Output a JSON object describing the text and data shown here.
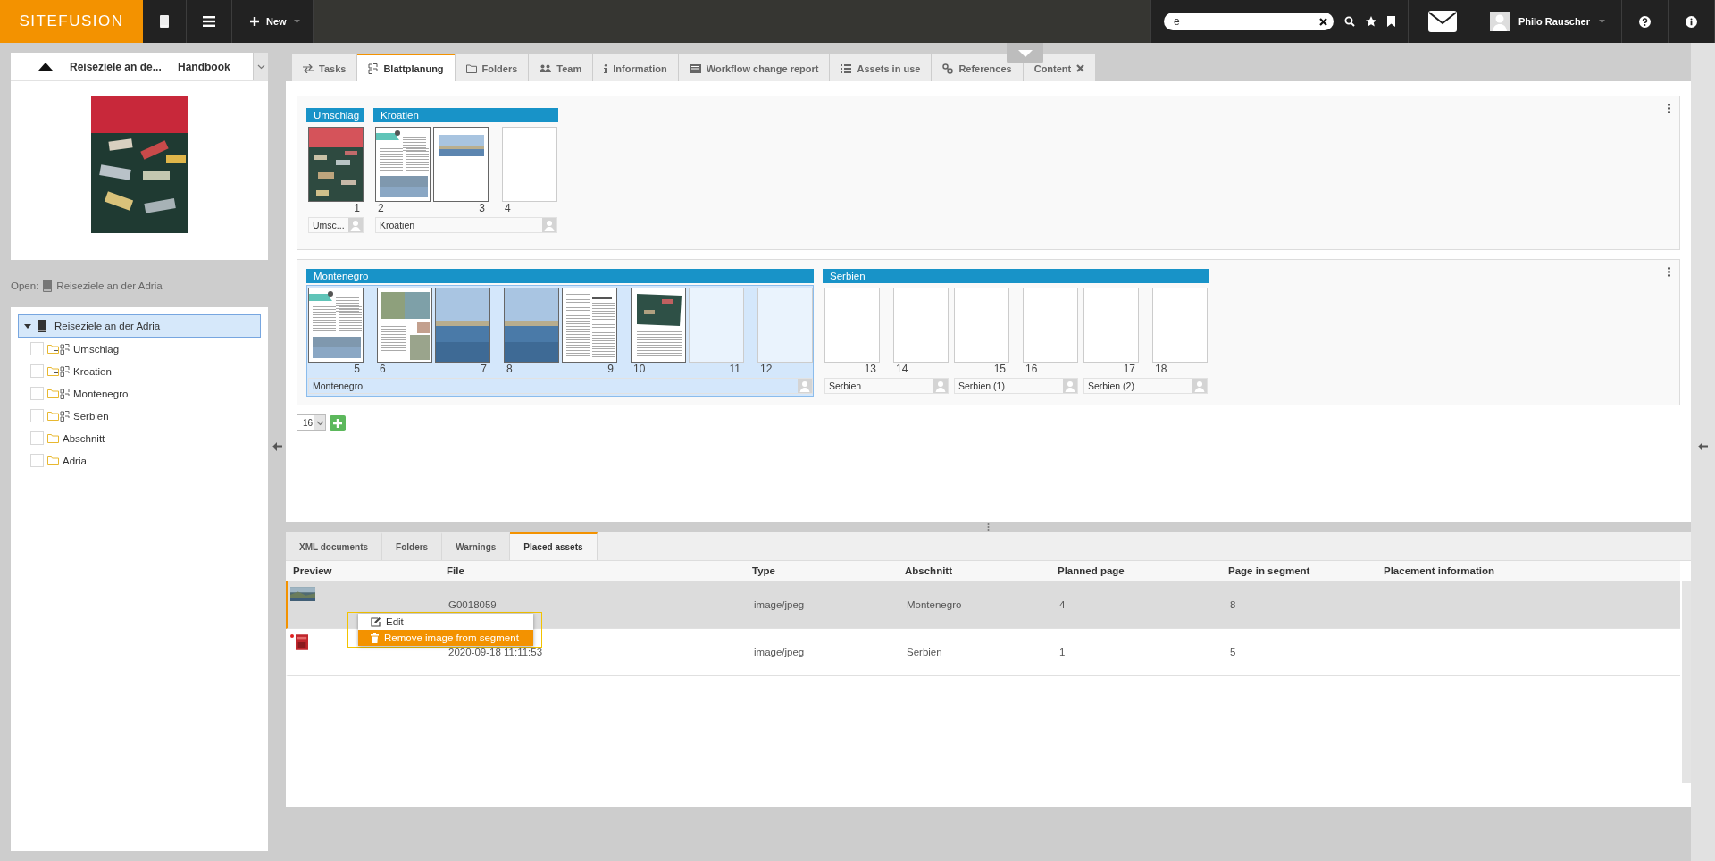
{
  "topbar": {
    "logo": "SITEFUSION",
    "new_button": "New",
    "search": {
      "value": "e"
    },
    "user": {
      "name": "Philo Rauscher"
    }
  },
  "document": {
    "title": "Reiseziele an de...",
    "type": "Handbook",
    "open_label": "Open:",
    "open_name": "Reiseziele an der Adria"
  },
  "tree": {
    "label": "Reiseziele an der Adria",
    "selected": true,
    "expanded": true,
    "children": [
      {
        "label": "Umschlag",
        "kind": "segment",
        "checked": false,
        "marked": true
      },
      {
        "label": "Kroatien",
        "kind": "segment",
        "checked": false,
        "marked": true
      },
      {
        "label": "Montenegro",
        "kind": "segment",
        "checked": false,
        "marked": false
      },
      {
        "label": "Serbien",
        "kind": "segment",
        "checked": false,
        "marked": false
      },
      {
        "label": "Abschnitt",
        "kind": "folder",
        "checked": false,
        "marked": false
      },
      {
        "label": "Adria",
        "kind": "folder",
        "checked": false,
        "marked": false
      }
    ]
  },
  "tabs": [
    {
      "label": "Tasks",
      "selected": false
    },
    {
      "label": "Blattplanung",
      "selected": true
    },
    {
      "label": "Folders",
      "selected": false
    },
    {
      "label": "Team",
      "selected": false
    },
    {
      "label": "Information",
      "selected": false
    },
    {
      "label": "Workflow change report",
      "selected": false
    },
    {
      "label": "Assets in use",
      "selected": false
    },
    {
      "label": "References",
      "selected": false
    },
    {
      "label": "Content",
      "selected": false,
      "closable": true
    }
  ],
  "sections": [
    {
      "segments": [
        {
          "title": "Umschlag",
          "selected": false,
          "groups": [
            {
              "label": "Umsc...",
              "pages": [
                {
                  "number": "1",
                  "recto": true,
                  "kind": "cover"
                }
              ]
            }
          ]
        },
        {
          "title": "Kroatien",
          "selected": false,
          "groups": [
            {
              "label": "Kroatien",
              "pages": [
                {
                  "number": "2",
                  "recto": false,
                  "kind": "article"
                },
                {
                  "number": "3",
                  "recto": true,
                  "kind": "photo-top"
                },
                {
                  "number": "4",
                  "recto": false,
                  "kind": "blank"
                }
              ]
            }
          ]
        }
      ]
    },
    {
      "segments": [
        {
          "title": "Montenegro",
          "selected": true,
          "groups": [
            {
              "label": "Montenegro",
              "pages": [
                {
                  "number": "5",
                  "recto": true,
                  "kind": "article"
                },
                {
                  "number": "6",
                  "recto": false,
                  "kind": "collage"
                },
                {
                  "number": "7",
                  "recto": true
                },
                {
                  "number": "8",
                  "recto": false
                },
                {
                  "number": "9",
                  "recto": true,
                  "kind": "text"
                },
                {
                  "number": "10",
                  "recto": false,
                  "kind": "image-text"
                },
                {
                  "number": "11",
                  "recto": true,
                  "kind": "blank"
                },
                {
                  "number": "12",
                  "recto": false,
                  "kind": "blank"
                }
              ]
            }
          ]
        },
        {
          "title": "Serbien",
          "selected": false,
          "groups": [
            {
              "label": "Serbien",
              "pages": [
                {
                  "number": "13",
                  "recto": true,
                  "kind": "blank"
                },
                {
                  "number": "14",
                  "recto": false,
                  "kind": "blank"
                }
              ]
            },
            {
              "label": "Serbien (1)",
              "pages": [
                {
                  "number": "15",
                  "recto": true,
                  "kind": "blank"
                },
                {
                  "number": "16",
                  "recto": false,
                  "kind": "blank"
                }
              ]
            },
            {
              "label": "Serbien (2)",
              "pages": [
                {
                  "number": "17",
                  "recto": true,
                  "kind": "blank"
                },
                {
                  "number": "18",
                  "recto": false,
                  "kind": "blank"
                }
              ]
            }
          ]
        }
      ]
    }
  ],
  "page_count": {
    "value": "16"
  },
  "bottom_tabs": [
    {
      "label": "XML documents",
      "selected": false
    },
    {
      "label": "Folders",
      "selected": false
    },
    {
      "label": "Warnings",
      "selected": false
    },
    {
      "label": "Placed assets",
      "selected": true
    }
  ],
  "table": {
    "columns": [
      "Preview",
      "File",
      "Type",
      "Abschnitt",
      "Planned page",
      "Page in segment",
      "Placement information"
    ],
    "rows": [
      {
        "selected": true,
        "flagged": false,
        "cells": [
          "",
          "G0018059",
          "image/jpeg",
          "Montenegro",
          "4",
          "8",
          ""
        ]
      },
      {
        "selected": false,
        "flagged": true,
        "kind": "book",
        "cells": [
          "",
          "2020-09-18 11:11:53",
          "image/jpeg",
          "Serbien",
          "1",
          "5",
          ""
        ]
      }
    ]
  },
  "context_menu": {
    "items": [
      {
        "label": "Edit",
        "selected": false
      },
      {
        "label": "Remove image from segment",
        "selected": true
      }
    ]
  }
}
